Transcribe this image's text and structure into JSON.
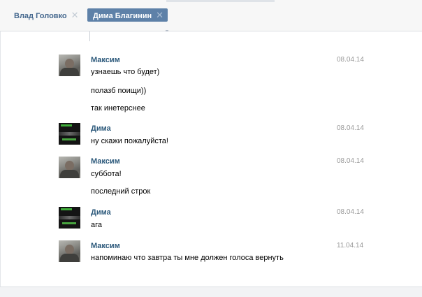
{
  "tabs": [
    {
      "label": "Влад Головко",
      "active": false
    },
    {
      "label": "Дима Благинин",
      "active": true
    }
  ],
  "colors": {
    "accent": "#5e81a8",
    "sender_name": "#2b587a",
    "date": "#999999",
    "background": "#edeef0"
  },
  "messages": [
    {
      "sender": "Максим",
      "date": "08.04.14",
      "avatar": "maxim-avatar",
      "texts": [
        "узнаешь что будет)",
        "полазб поищи))",
        "так инетерснее"
      ]
    },
    {
      "sender": "Дима",
      "date": "08.04.14",
      "avatar": "dima-avatar",
      "texts": [
        "ну скажи пожалуйста!"
      ]
    },
    {
      "sender": "Максим",
      "date": "08.04.14",
      "avatar": "maxim-avatar",
      "texts": [
        "суббота!",
        "последний строк"
      ]
    },
    {
      "sender": "Дима",
      "date": "08.04.14",
      "avatar": "dima-avatar",
      "texts": [
        "ага"
      ]
    },
    {
      "sender": "Максим",
      "date": "11.04.14",
      "avatar": "maxim-avatar",
      "texts": [
        "напоминаю что завтра ты мне должен голоса вернуть"
      ]
    }
  ]
}
